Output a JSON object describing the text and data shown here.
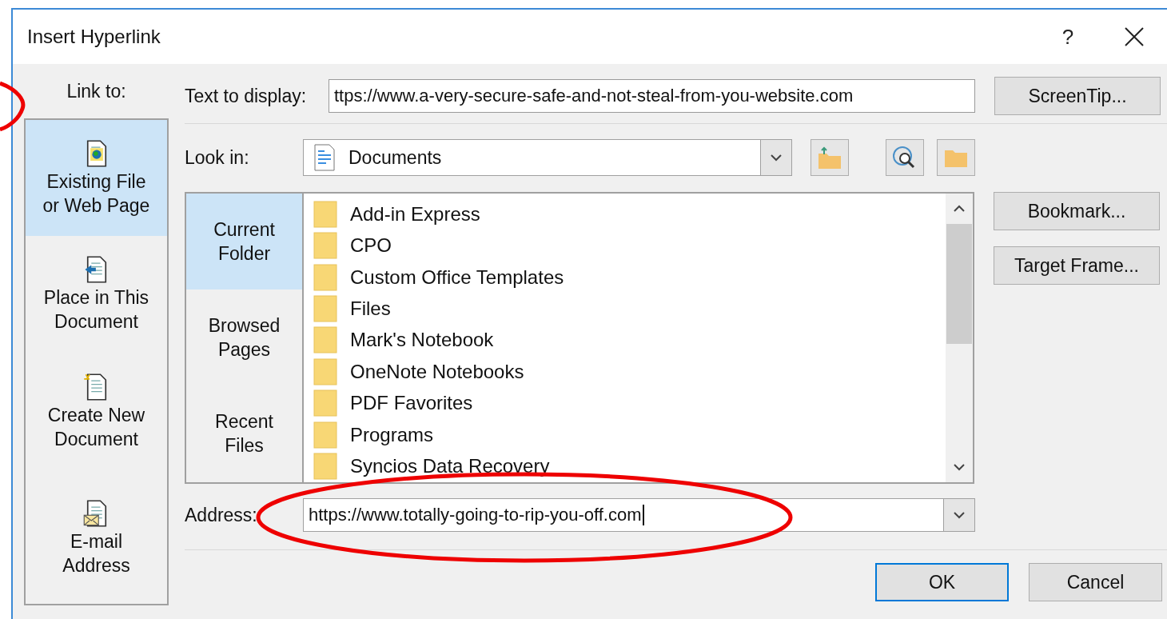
{
  "window": {
    "title": "Insert Hyperlink",
    "help": "?"
  },
  "link_to": {
    "label": "Link to:",
    "items": [
      {
        "kind": "web",
        "lines": [
          "Existing File",
          "or Web Page"
        ],
        "selected": true
      },
      {
        "kind": "place",
        "lines": [
          "Place in This",
          "Document"
        ],
        "selected": false
      },
      {
        "kind": "new",
        "lines": [
          "Create New",
          "Document"
        ],
        "selected": false
      },
      {
        "kind": "mail",
        "lines": [
          "E-mail",
          "Address"
        ],
        "selected": false
      }
    ]
  },
  "text_to_display": {
    "label": "Text to display:",
    "value": "ttps://www.a-very-secure-safe-and-not-steal-from-you-website.com"
  },
  "look_in": {
    "label": "Look in:",
    "value": "Documents"
  },
  "browse_tabs": [
    {
      "lines": [
        "Current",
        "Folder"
      ],
      "selected": true
    },
    {
      "lines": [
        "Browsed",
        "Pages"
      ],
      "selected": false
    },
    {
      "lines": [
        "Recent",
        "Files"
      ],
      "selected": false
    }
  ],
  "files": [
    "Add-in Express",
    "CPO",
    "Custom Office Templates",
    "Files",
    "Mark's Notebook",
    "OneNote Notebooks",
    "PDF Favorites",
    "Programs",
    "Syncios Data Recovery"
  ],
  "side_buttons": [
    "ScreenTip...",
    "Bookmark...",
    "Target Frame..."
  ],
  "address": {
    "label": "Address:",
    "value": "https://www.totally-going-to-rip-you-off.com"
  },
  "footer_buttons": [
    {
      "label": "OK",
      "default": true
    },
    {
      "label": "Cancel",
      "default": false
    }
  ]
}
